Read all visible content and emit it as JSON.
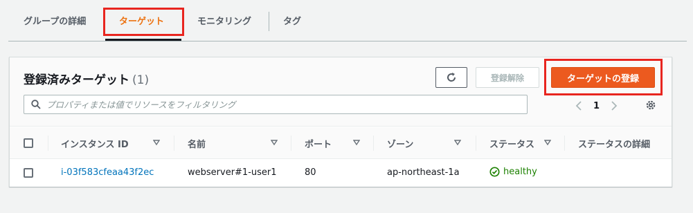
{
  "tabs": [
    {
      "label": "グループの詳細"
    },
    {
      "label": "ターゲット"
    },
    {
      "label": "モニタリング"
    },
    {
      "label": "タグ"
    }
  ],
  "panel": {
    "title": "登録済みターゲット",
    "count": "(1)",
    "deregister_label": "登録解除",
    "register_label": "ターゲットの登録"
  },
  "search": {
    "placeholder": "プロパティまたは値でリソースをフィルタリング"
  },
  "pagination": {
    "current_page": "1"
  },
  "table": {
    "columns": [
      {
        "label": "インスタンス ID"
      },
      {
        "label": "名前"
      },
      {
        "label": "ポート"
      },
      {
        "label": "ゾーン"
      },
      {
        "label": "ステータス"
      },
      {
        "label": "ステータスの詳細"
      }
    ],
    "rows": [
      {
        "instance_id": "i-03f583cfeaa43f2ec",
        "name": "webserver#1-user1",
        "port": "80",
        "zone": "ap-northeast-1a",
        "status": "healthy",
        "status_detail": ""
      }
    ]
  },
  "colors": {
    "accent": "#ec7211",
    "primary_button": "#ec5a1f",
    "link": "#0073bb",
    "success": "#1d8102",
    "highlight": "#e8251f"
  },
  "icons": {
    "refresh": "refresh-icon",
    "search": "search-icon",
    "prev": "chevron-left-icon",
    "next": "chevron-right-icon",
    "settings": "gear-icon",
    "sort": "caret-down-icon",
    "status": "check-circle-icon"
  }
}
